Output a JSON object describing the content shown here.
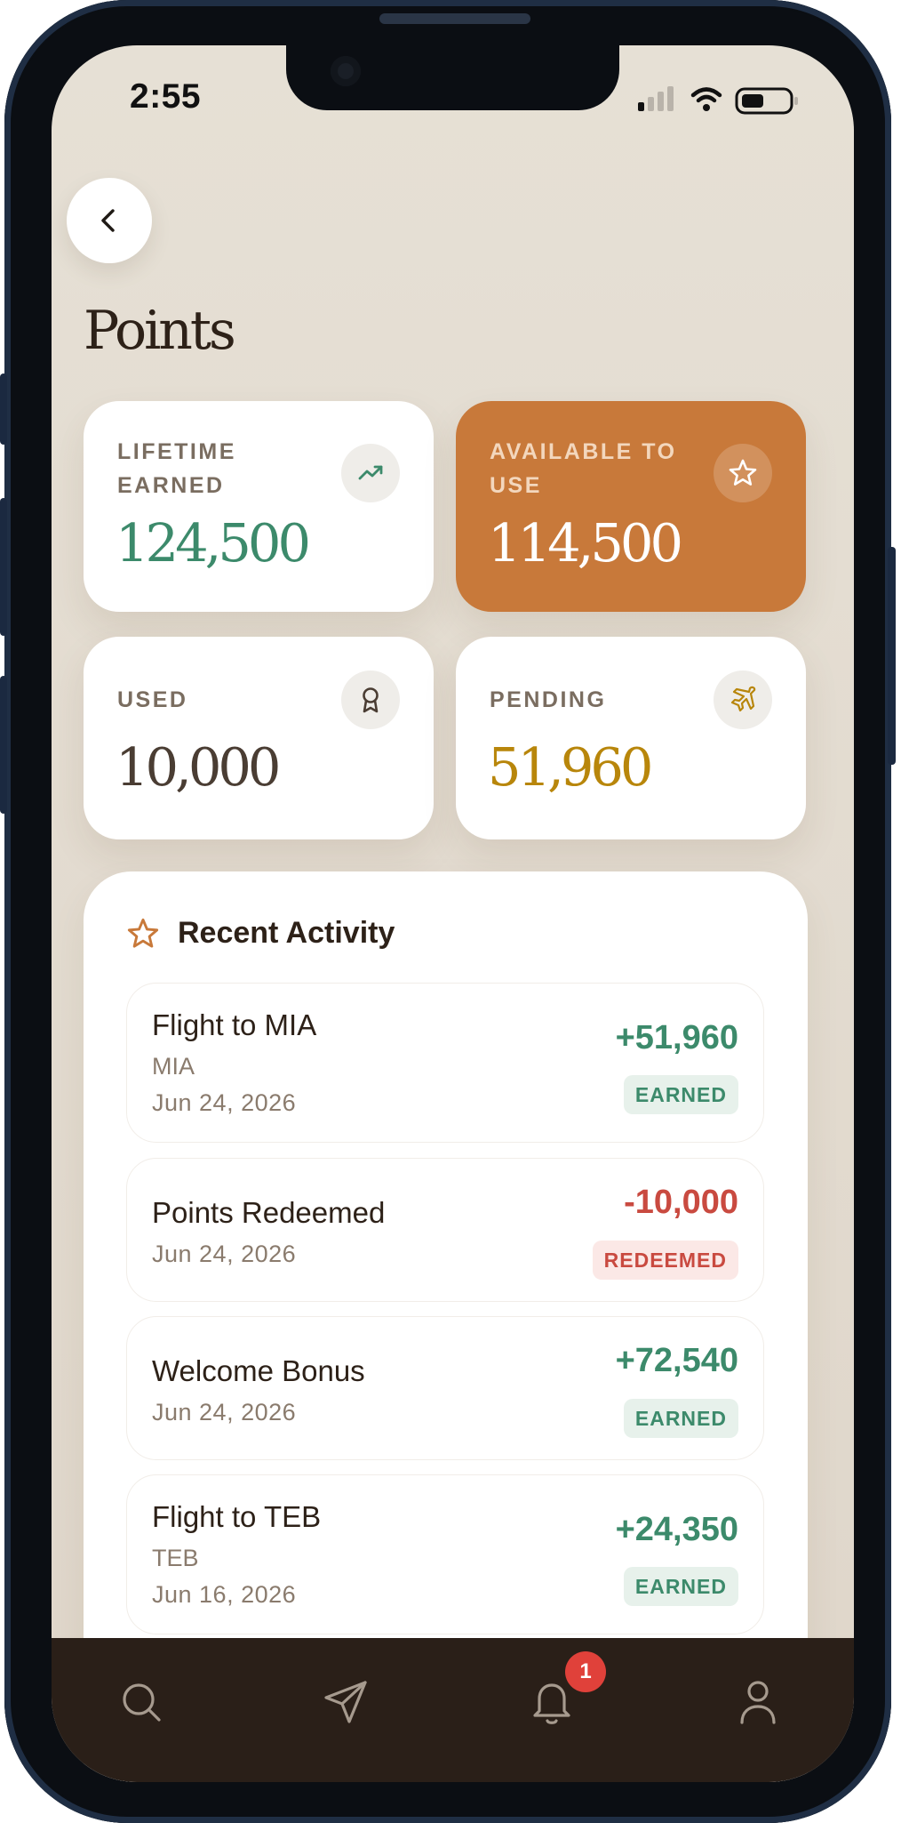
{
  "status_bar": {
    "time": "2:55"
  },
  "header": {
    "title": "Points"
  },
  "cards": {
    "lifetime": {
      "label": "LIFETIME EARNED",
      "value": "124,500",
      "color": "#3c8a6b",
      "icon": "trending-up-icon"
    },
    "available": {
      "label": "AVAILABLE TO USE",
      "value": "114,500",
      "color": "#ffffff",
      "background": "#c8793a",
      "icon": "star-icon"
    },
    "used": {
      "label": "USED",
      "value": "10,000",
      "color": "#4a3d33",
      "icon": "award-icon"
    },
    "pending": {
      "label": "PENDING",
      "value": "51,960",
      "color": "#b8860b",
      "icon": "plane-icon"
    }
  },
  "activity": {
    "title": "Recent Activity",
    "items": [
      {
        "name": "Flight to MIA",
        "sub": "MIA",
        "date": "Jun 24, 2026",
        "amount": "+51,960",
        "badge": "EARNED"
      },
      {
        "name": "Points Redeemed",
        "date": "Jun 24, 2026",
        "amount": "-10,000",
        "badge": "REDEEMED"
      },
      {
        "name": "Welcome Bonus",
        "date": "Jun 24, 2026",
        "amount": "+72,540",
        "badge": "EARNED"
      },
      {
        "name": "Flight to TEB",
        "sub": "TEB",
        "date": "Jun 16, 2026",
        "amount": "+24,350",
        "badge": "EARNED"
      }
    ]
  },
  "tabbar": {
    "items": [
      "search-icon",
      "send-icon",
      "bell-icon",
      "user-icon"
    ],
    "notification_count": "1"
  },
  "colors": {
    "accent": "#c8793a",
    "positive": "#3c8a6b",
    "negative": "#c94a40",
    "tabbar": "#2a1f18"
  }
}
